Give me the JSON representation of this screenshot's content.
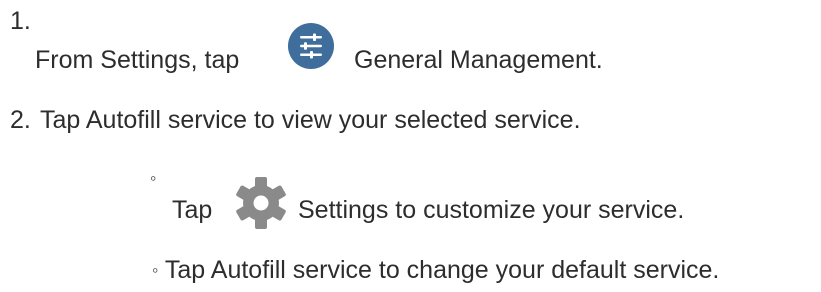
{
  "steps": [
    {
      "number": "1.",
      "text_before": "From Settings, tap",
      "icon": "general-management-icon",
      "text_after": "General Management."
    },
    {
      "number": "2.",
      "text": "Tap Autofill service to view your selected service."
    }
  ],
  "substeps": [
    {
      "bullet": "◦",
      "text_before": "Tap",
      "icon": "settings-gear-icon",
      "text_after": "Settings to customize your service."
    },
    {
      "bullet": "◦",
      "text": "Tap Autofill service to change your default service."
    }
  ],
  "colors": {
    "text": "#2d2d2d",
    "general_management_icon": "#3f6e9c",
    "gear_icon": "#8a8a8a"
  }
}
